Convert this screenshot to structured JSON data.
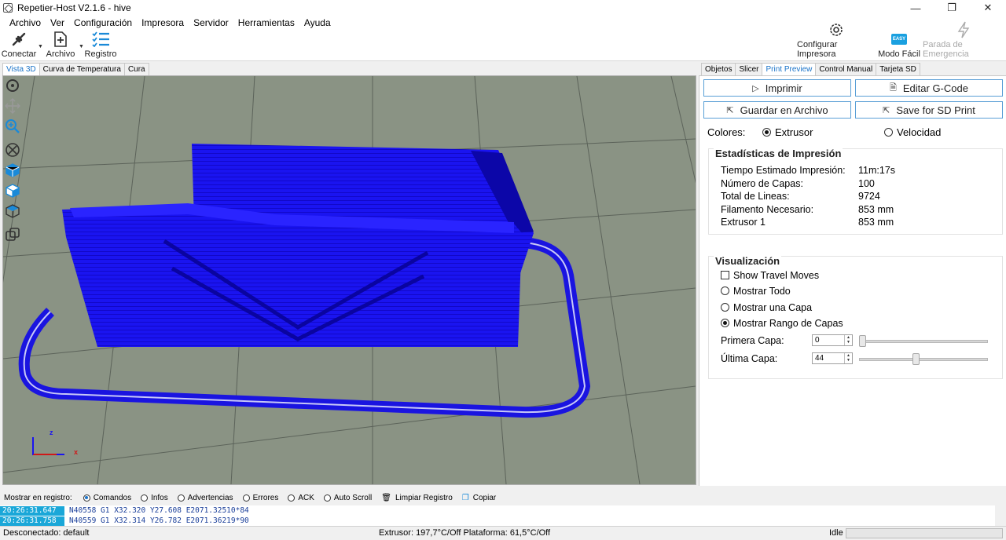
{
  "window": {
    "title": "Repetier-Host V2.1.6 - hive",
    "minimize": "—",
    "maximize": "❐",
    "close": "✕"
  },
  "menu": [
    "Archivo",
    "Ver",
    "Configuración",
    "Impresora",
    "Servidor",
    "Herramientas",
    "Ayuda"
  ],
  "toolbar": {
    "connect": "Conectar",
    "file": "Archivo",
    "log": "Registro",
    "configure_printer": "Configurar Impresora",
    "easy_mode": "Modo Fácil",
    "easy_badge": "EASY",
    "emergency_stop": "Parada de Emergencia"
  },
  "left_tabs": [
    "Vista 3D",
    "Curva de Temperatura",
    "Cura"
  ],
  "right_tabs": [
    "Objetos",
    "Slicer",
    "Print Preview",
    "Control Manual",
    "Tarjeta SD"
  ],
  "print_preview": {
    "print": "Imprimir",
    "edit_gcode": "Editar G-Code",
    "save_file": "Guardar en Archivo",
    "save_sd": "Save for SD Print",
    "colors_label": "Colores:",
    "color_extruder": "Extrusor",
    "color_speed": "Velocidad",
    "stats_title": "Estadísticas de Impresión",
    "stats": [
      {
        "k": "Tiempo Estimado Impresión:",
        "v": "11m:17s"
      },
      {
        "k": "Número de Capas:",
        "v": "100"
      },
      {
        "k": "Total de Lineas:",
        "v": "9724"
      },
      {
        "k": "Filamento Necesario:",
        "v": "853 mm"
      },
      {
        "k": "Extrusor 1",
        "v": "853 mm"
      }
    ],
    "vis_title": "Visualización",
    "show_travel": "Show Travel Moves",
    "show_all": "Mostrar Todo",
    "show_one": "Mostrar una Capa",
    "show_range": "Mostrar Rango de Capas",
    "first_layer_label": "Primera Capa:",
    "first_layer_value": "0",
    "last_layer_label": "Última Capa:",
    "last_layer_value": "44",
    "first_layer_fraction": 0.0,
    "last_layer_fraction": 0.44
  },
  "log": {
    "show_label": "Mostrar en registro:",
    "commands": "Comandos",
    "infos": "Infos",
    "warnings": "Advertencias",
    "errors": "Errores",
    "ack": "ACK",
    "autoscroll": "Auto Scroll",
    "clear": "Limpiar Registro",
    "copy": "Copiar",
    "lines": [
      {
        "ts": "20:26:31.647",
        "msg": "N40558 G1 X32.320 Y27.608 E2071.32510*84"
      },
      {
        "ts": "20:26:31.758",
        "msg": "N40559 G1 X32.314 Y26.782 E2071.36219*90"
      }
    ]
  },
  "status": {
    "connection": "Desconectado: default",
    "temps": "Extrusor: 197,7°C/Off Plataforma: 61,5°C/Off",
    "state": "Idle"
  },
  "axes": {
    "z": "z",
    "x": "x"
  },
  "colors": {
    "accent": "#1a73c8",
    "model": "#1a14f0",
    "floor": "#8a9384"
  }
}
